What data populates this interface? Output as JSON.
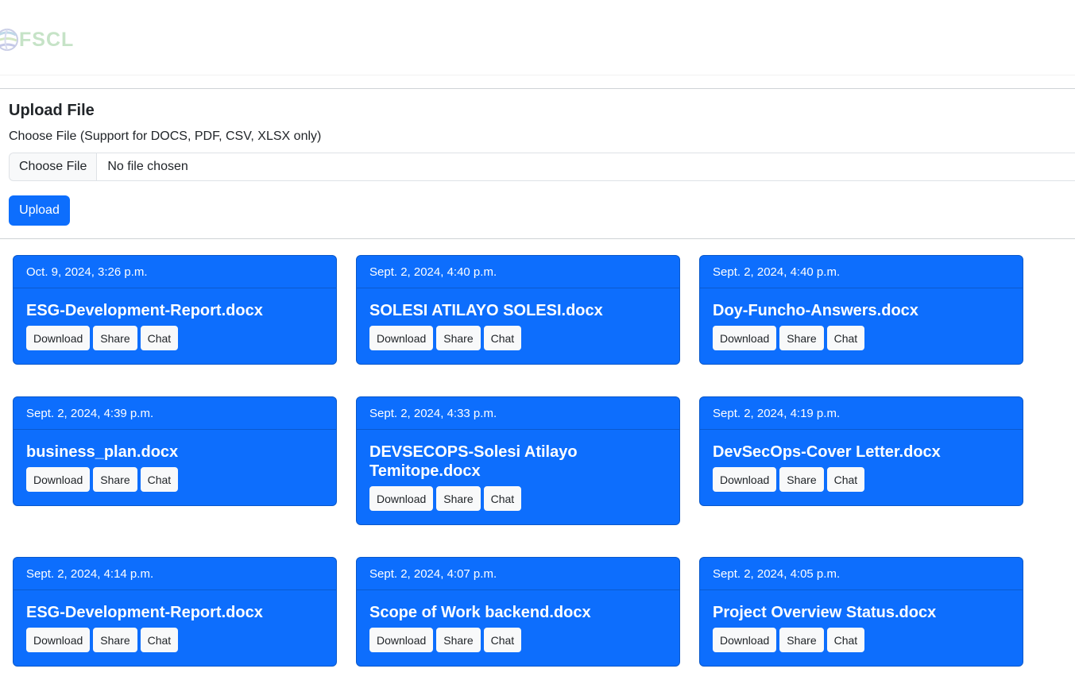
{
  "header": {
    "logo_text": "FSCL",
    "logo_color": "#c6e3c7"
  },
  "upload": {
    "title": "Upload File",
    "label": "Choose File (Support for DOCS, PDF, CSV, XLSX only)",
    "choose_button": "Choose File",
    "file_status": "No file chosen",
    "upload_button": "Upload"
  },
  "theme": {
    "primary": "#0d6efd",
    "light_button": "#f8f9fa"
  },
  "files": [
    {
      "date": "Oct. 9, 2024, 3:26 p.m.",
      "name": "ESG-Development-Report.docx",
      "download": "Download",
      "share": "Share",
      "chat": "Chat"
    },
    {
      "date": "Sept. 2, 2024, 4:40 p.m.",
      "name": "SOLESI ATILAYO SOLESI.docx",
      "download": "Download",
      "share": "Share",
      "chat": "Chat"
    },
    {
      "date": "Sept. 2, 2024, 4:40 p.m.",
      "name": "Doy-Funcho-Answers.docx",
      "download": "Download",
      "share": "Share",
      "chat": "Chat"
    },
    {
      "date": "Sept. 2, 2024, 4:39 p.m.",
      "name": "business_plan.docx",
      "download": "Download",
      "share": "Share",
      "chat": "Chat"
    },
    {
      "date": "Sept. 2, 2024, 4:33 p.m.",
      "name": "DEVSECOPS-Solesi Atilayo Temitope.docx",
      "download": "Download",
      "share": "Share",
      "chat": "Chat"
    },
    {
      "date": "Sept. 2, 2024, 4:19 p.m.",
      "name": "DevSecOps-Cover Letter.docx",
      "download": "Download",
      "share": "Share",
      "chat": "Chat"
    },
    {
      "date": "Sept. 2, 2024, 4:14 p.m.",
      "name": "ESG-Development-Report.docx",
      "download": "Download",
      "share": "Share",
      "chat": "Chat"
    },
    {
      "date": "Sept. 2, 2024, 4:07 p.m.",
      "name": "Scope of Work backend.docx",
      "download": "Download",
      "share": "Share",
      "chat": "Chat"
    },
    {
      "date": "Sept. 2, 2024, 4:05 p.m.",
      "name": "Project Overview Status.docx",
      "download": "Download",
      "share": "Share",
      "chat": "Chat"
    }
  ]
}
